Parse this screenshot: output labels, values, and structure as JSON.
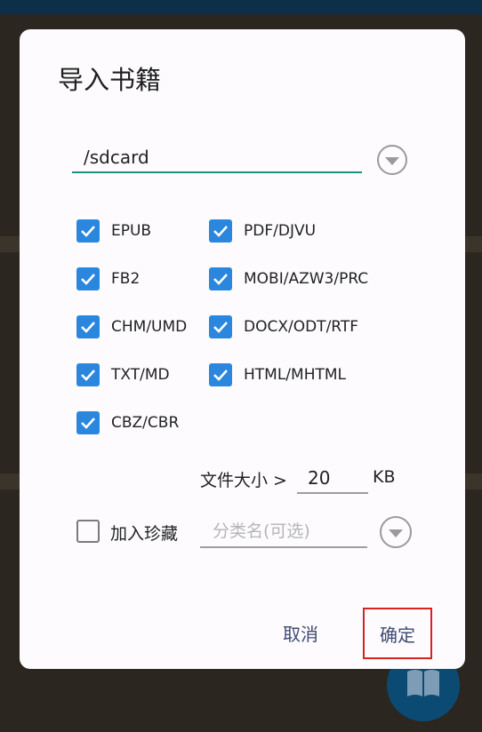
{
  "dialog": {
    "title": "导入书籍",
    "path_value": "/sdcard",
    "formats": [
      {
        "label": "EPUB",
        "checked": true
      },
      {
        "label": "PDF/DJVU",
        "checked": true
      },
      {
        "label": "FB2",
        "checked": true
      },
      {
        "label": "MOBI/AZW3/PRC",
        "checked": true
      },
      {
        "label": "CHM/UMD",
        "checked": true
      },
      {
        "label": "DOCX/ODT/RTF",
        "checked": true
      },
      {
        "label": "TXT/MD",
        "checked": true
      },
      {
        "label": "HTML/MHTML",
        "checked": true
      },
      {
        "label": "CBZ/CBR",
        "checked": true
      }
    ],
    "size_label": "文件大小 >",
    "size_value": "20",
    "size_unit": "KB",
    "favorite": {
      "label": "加入珍藏",
      "checked": false
    },
    "category_placeholder": "分类名(可选)",
    "cancel_label": "取消",
    "confirm_label": "确定"
  },
  "colors": {
    "accent": "#2b86dd",
    "teal_underline": "#1c8f87",
    "button_text": "#3e4a72",
    "highlight_red": "#d9211f"
  },
  "icons": {
    "path_dropdown": "chevron-down-circle-icon",
    "category_dropdown": "chevron-down-circle-icon",
    "fab": "book-icon",
    "checkmark": "check-icon"
  }
}
